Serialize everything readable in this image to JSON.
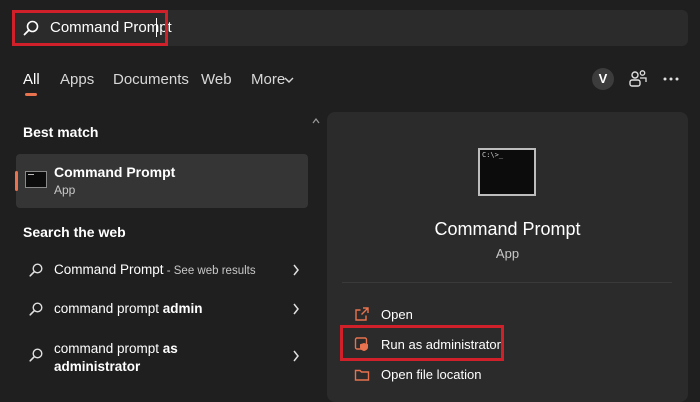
{
  "search": {
    "query": "Command Prompt"
  },
  "tabs": [
    {
      "label": "All"
    },
    {
      "label": "Apps"
    },
    {
      "label": "Documents"
    },
    {
      "label": "Web"
    },
    {
      "label": "More"
    }
  ],
  "account": {
    "initial": "V"
  },
  "best_match": {
    "title": "Best match",
    "name": "Command Prompt",
    "type": "App"
  },
  "search_web": {
    "title": "Search the web",
    "items": [
      {
        "text": "Command Prompt",
        "sub": " - See web results"
      },
      {
        "text_prefix": "command prompt ",
        "text_bold": "admin"
      },
      {
        "line1_prefix": "command prompt ",
        "line1_bold": "as",
        "line2_bold": "administrator"
      }
    ]
  },
  "detail": {
    "icon_prompt": "C:\\>_",
    "title": "Command Prompt",
    "type": "App",
    "actions": [
      {
        "label": "Open"
      },
      {
        "label": "Run as administrator"
      },
      {
        "label": "Open file location"
      }
    ]
  },
  "colors": {
    "accent": "#e8734e",
    "highlight_border": "#d0212b",
    "background": "#1f1f1f",
    "panel": "#2b2b2b"
  }
}
